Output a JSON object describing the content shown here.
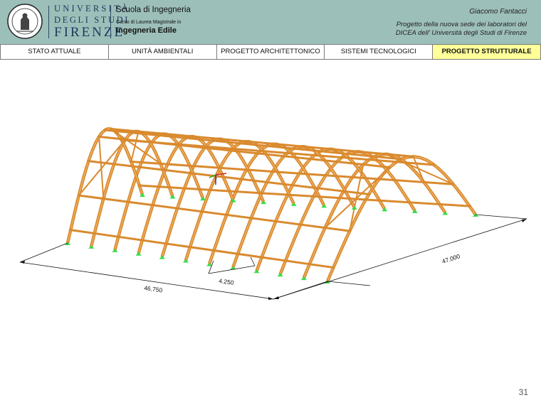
{
  "header": {
    "university": {
      "line1": "UNIVERSITÀ",
      "line2": "DEGLI STUDI",
      "line3": "FIRENZE"
    },
    "school": "Scuola di Ingegneria",
    "course_prefix": "Corso di Laurea Magistrale in",
    "course": "Ingegneria Edile",
    "author": "Giacomo Fantacci",
    "project_line1": "Progetto della nuova sede dei laboratori del",
    "project_line2": "DICEA dell' Università degli Studi di Firenze"
  },
  "nav": {
    "tabs": [
      {
        "label": "STATO ATTUALE",
        "active": false
      },
      {
        "label": "UNITÀ AMBIENTALI",
        "active": false
      },
      {
        "label": "PROGETTO ARCHITETTONICO",
        "active": false
      },
      {
        "label": "SISTEMI TECNOLOGICI",
        "active": false
      },
      {
        "label": "PROGETTO STRUTTURALE",
        "active": true
      }
    ]
  },
  "dimensions": {
    "length": "46.750",
    "width": "47.000",
    "spacing": "4.250"
  },
  "page_number": "31",
  "colors": {
    "header_bg": "#9dbfb9",
    "active_tab": "#ffff99",
    "timber": "#d98a2e",
    "support": "#33dd44"
  }
}
